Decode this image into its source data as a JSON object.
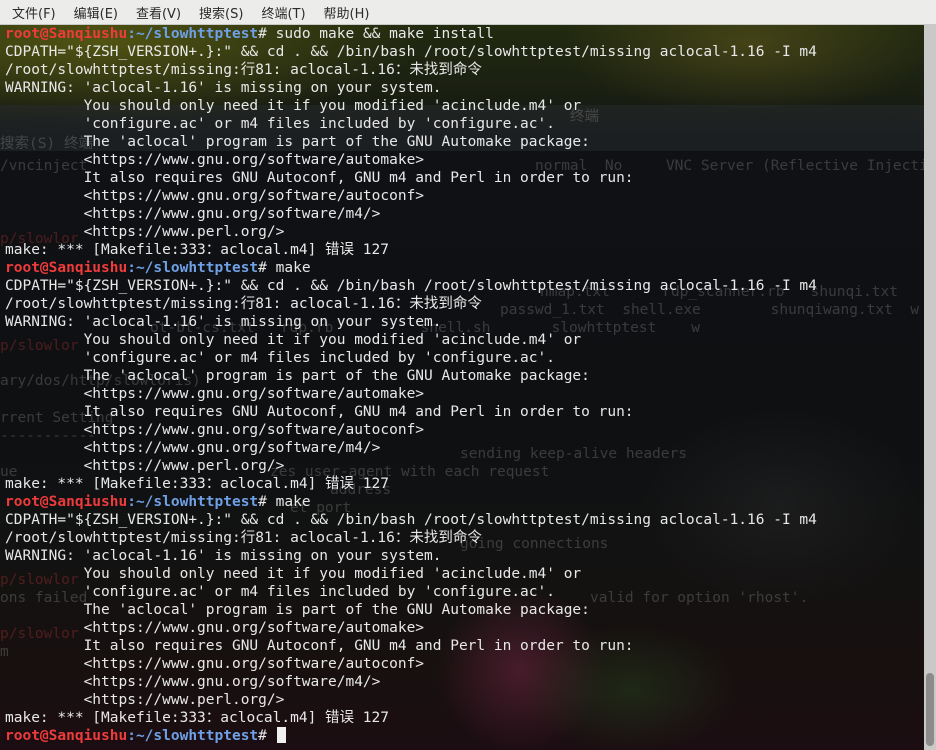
{
  "menubar": {
    "items": [
      "文件(F)",
      "编辑(E)",
      "查看(V)",
      "搜索(S)",
      "终端(T)",
      "帮助(H)"
    ]
  },
  "terminal": {
    "user_host": "root@Sanqiushu",
    "path": ":~/slowhttptest",
    "prompt_symbol": "# ",
    "blocks": [
      {
        "command": "sudo make && make install",
        "output": [
          "CDPATH=\"${ZSH_VERSION+.}:\" && cd . && /bin/bash /root/slowhttptest/missing aclocal-1.16 -I m4",
          "/root/slowhttptest/missing:行81: aclocal-1.16：未找到命令",
          "WARNING: 'aclocal-1.16' is missing on your system.",
          "         You should only need it if you modified 'acinclude.m4' or",
          "         'configure.ac' or m4 files included by 'configure.ac'.",
          "         The 'aclocal' program is part of the GNU Automake package:",
          "         <https://www.gnu.org/software/automake>",
          "         It also requires GNU Autoconf, GNU m4 and Perl in order to run:",
          "         <https://www.gnu.org/software/autoconf>",
          "         <https://www.gnu.org/software/m4/>",
          "         <https://www.perl.org/>",
          "make: *** [Makefile:333：aclocal.m4] 错误 127"
        ]
      },
      {
        "command": "make",
        "output": [
          "CDPATH=\"${ZSH_VERSION+.}:\" && cd . && /bin/bash /root/slowhttptest/missing aclocal-1.16 -I m4",
          "/root/slowhttptest/missing:行81: aclocal-1.16：未找到命令",
          "WARNING: 'aclocal-1.16' is missing on your system.",
          "         You should only need it if you modified 'acinclude.m4' or",
          "         'configure.ac' or m4 files included by 'configure.ac'.",
          "         The 'aclocal' program is part of the GNU Automake package:",
          "         <https://www.gnu.org/software/automake>",
          "         It also requires GNU Autoconf, GNU m4 and Perl in order to run:",
          "         <https://www.gnu.org/software/autoconf>",
          "         <https://www.gnu.org/software/m4/>",
          "         <https://www.perl.org/>",
          "make: *** [Makefile:333：aclocal.m4] 错误 127"
        ]
      },
      {
        "command": "make",
        "output": [
          "CDPATH=\"${ZSH_VERSION+.}:\" && cd . && /bin/bash /root/slowhttptest/missing aclocal-1.16 -I m4",
          "/root/slowhttptest/missing:行81: aclocal-1.16：未找到命令",
          "WARNING: 'aclocal-1.16' is missing on your system.",
          "         You should only need it if you modified 'acinclude.m4' or",
          "         'configure.ac' or m4 files included by 'configure.ac'.",
          "         The 'aclocal' program is part of the GNU Automake package:",
          "         <https://www.gnu.org/software/automake>",
          "         It also requires GNU Autoconf, GNU m4 and Perl in order to run:",
          "         <https://www.gnu.org/software/autoconf>",
          "         <https://www.gnu.org/software/m4/>",
          "         <https://www.perl.org/>",
          "make: *** [Makefile:333：aclocal.m4] 错误 127"
        ]
      }
    ],
    "current_input": ""
  },
  "background_window": {
    "title": "终端",
    "menu_fragment": [
      "搜索(S)",
      "终端"
    ],
    "texts": [
      "/vncinject",
      "normal  No     VNC Server (Reflective Injection)",
      "p/slowlor",
      "p/slowlor",
      "nmap.txt      rdp_scanner.rb   shunqi.txt    w",
      "passwd_1.txt  shell.exe        shunqiwang.txt  w",
      "ot-bt-cs.txt   rdp.rb          shell.sh       slowhttptest    w",
      "ary/dos/http/slowloris)",
      "rrent Setting",
      "-----------",
      "sending keep-alive headers",
      "ue",
      "zes user-agent with each request",
      "address",
      "et port",
      "going connections",
      "p/slowlor",
      "ons failed",
      "valid for option 'rhost'.",
      "p/slowlor",
      "m"
    ]
  },
  "colors": {
    "prompt_user": "#ef3b3b",
    "prompt_path": "#6fa0e6",
    "text": "#e8e8e8",
    "menubar_bg": "#ececea",
    "scrollbar_bg": "#c9c9c7",
    "scroll_thumb": "#8b8b89"
  }
}
